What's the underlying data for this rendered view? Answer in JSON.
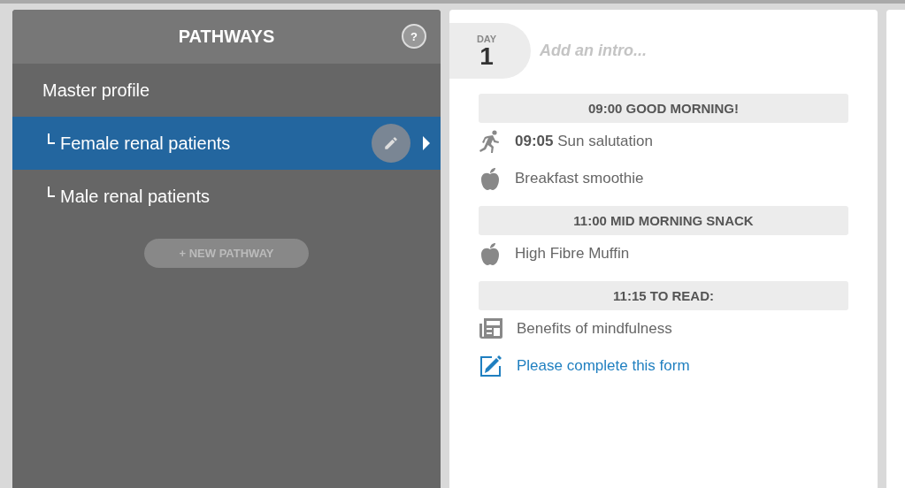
{
  "pathways": {
    "title": "PATHWAYS",
    "help": "?",
    "items": [
      {
        "label": "Master profile",
        "selected": false,
        "children": [
          {
            "label": "Female renal patients",
            "selected": true
          },
          {
            "label": "Male renal patients",
            "selected": false
          }
        ]
      }
    ],
    "new_button": "+ NEW PATHWAY"
  },
  "day": {
    "label": "DAY",
    "number": "1",
    "intro": {
      "placeholder": "Add an intro..."
    },
    "sections": [
      {
        "heading": "09:00 GOOD MORNING!",
        "entries": [
          {
            "kind": "exercise",
            "text": "**09:05** Sun salutation"
          },
          {
            "kind": "food",
            "text": "Breakfast smoothie"
          }
        ]
      },
      {
        "heading": "11:00 MID MORNING SNACK",
        "entries": [
          {
            "kind": "food",
            "text": "High Fibre Muffin"
          }
        ]
      },
      {
        "heading": "11:15 TO READ:",
        "entries": [
          {
            "kind": "article",
            "text": "Benefits of mindfulness"
          },
          {
            "kind": "form",
            "text": "Please complete this form"
          }
        ]
      }
    ]
  }
}
